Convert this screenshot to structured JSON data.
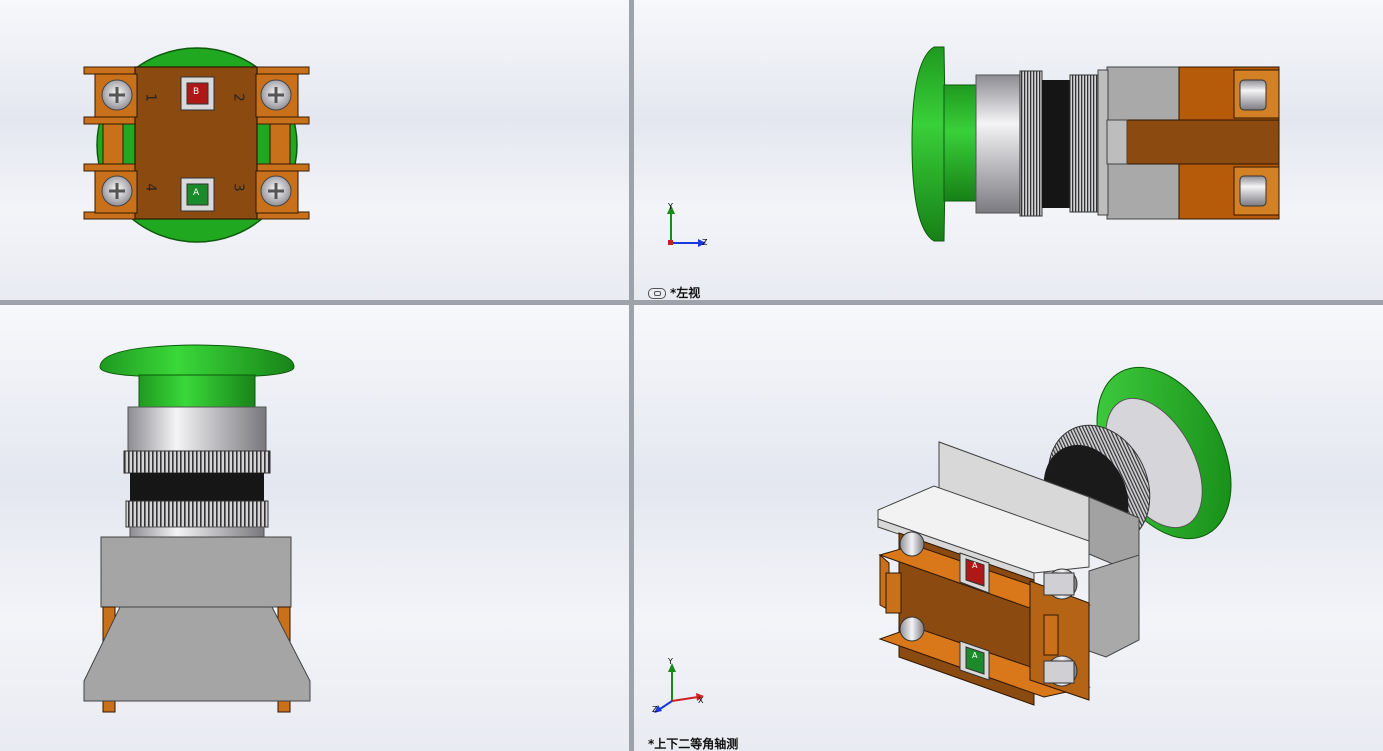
{
  "viewports": {
    "top_left": {
      "terminals": [
        "1",
        "2",
        "4",
        "3"
      ],
      "window_top": "B",
      "window_bottom": "A"
    },
    "top_right": {
      "label": "*左视",
      "triad": {
        "y": "Y",
        "z": "Z"
      }
    },
    "bottom_left": {},
    "bottom_right": {
      "label": "*上下二等角轴测",
      "triad": {
        "y": "Y",
        "x": "X",
        "z": "Z"
      },
      "window_top": "A",
      "window_bottom": "A"
    }
  },
  "colors": {
    "button_green": "#22b022",
    "contact_brown": "#8a4a10",
    "contact_orange": "#d8781a",
    "bezel_silver": "#c8c8cc",
    "housing_gray": "#a5a5a5",
    "window_red": "#b01818",
    "window_green": "#1a8a2a"
  },
  "icons": [
    "link-icon",
    "screw-icon",
    "triad-icon"
  ]
}
